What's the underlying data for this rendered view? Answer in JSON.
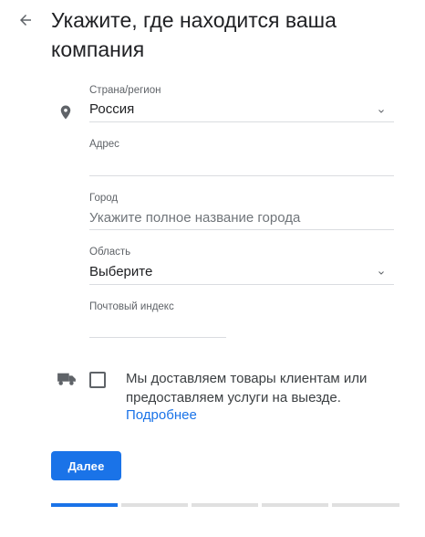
{
  "header": {
    "title": "Укажите, где находится ваша компания",
    "back_icon": "arrow-left-icon"
  },
  "form": {
    "country": {
      "label": "Страна/регион",
      "value": "Россия",
      "icon": "location-pin-icon"
    },
    "address": {
      "label": "Адрес",
      "value": ""
    },
    "city": {
      "label": "Город",
      "placeholder": "Укажите полное название города"
    },
    "region": {
      "label": "Область",
      "value": "Выберите"
    },
    "postal": {
      "label": "Почтовый индекс",
      "value": ""
    }
  },
  "delivery": {
    "icon": "truck-icon",
    "text": "Мы доставляем товары клиентам или предоставляем услуги на выезде.",
    "link": "Подробнее",
    "checked": false
  },
  "actions": {
    "next_label": "Далее"
  },
  "progress": {
    "current_step": 1,
    "total_steps": 5
  },
  "colors": {
    "accent": "#1a73e8",
    "text": "#202124",
    "muted": "#5f6368",
    "divider": "#dadce0"
  }
}
